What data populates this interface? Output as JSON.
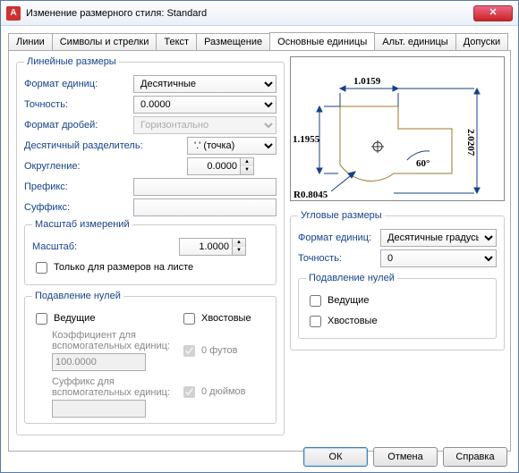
{
  "window": {
    "title": "Изменение размерного стиля: Standard"
  },
  "tabs": {
    "t1": "Линии",
    "t2": "Символы и стрелки",
    "t3": "Текст",
    "t4": "Размещение",
    "t5": "Основные единицы",
    "t6": "Альт. единицы",
    "t7": "Допуски"
  },
  "linear": {
    "legend": "Линейные размеры",
    "format_lbl": "Формат единиц:",
    "format_val": "Десятичные",
    "precision_lbl": "Точность:",
    "precision_val": "0.0000",
    "frac_lbl": "Формат дробей:",
    "frac_val": "Горизонтально",
    "decsep_lbl": "Десятичный разделитель:",
    "decsep_val": "'.' (точка)",
    "round_lbl": "Округление:",
    "round_val": "0.0000",
    "prefix_lbl": "Префикс:",
    "prefix_val": "",
    "suffix_lbl": "Суффикс:",
    "suffix_val": ""
  },
  "scale": {
    "legend": "Масштаб измерений",
    "scale_lbl": "Масштаб:",
    "scale_val": "1.0000",
    "layout_only": "Только для размеров на листе"
  },
  "zeros": {
    "legend": "Подавление нулей",
    "leading": "Ведущие",
    "coef_lbl": "Коэффициент для вспомогательных единиц:",
    "coef_val": "100.0000",
    "suf_lbl": "Суффикс для вспомогательных единиц:",
    "suf_val": "",
    "trailing": "Хвостовые",
    "feet": "0 футов",
    "inches": "0 дюймов"
  },
  "ang": {
    "legend": "Угловые размеры",
    "format_lbl": "Формат единиц:",
    "format_val": "Десятичные градусы",
    "precision_lbl": "Точность:",
    "precision_val": "0",
    "zeros_legend": "Подавление нулей",
    "leading": "Ведущие",
    "trailing": "Хвостовые"
  },
  "preview": {
    "d1": "1.0159",
    "d2": "1.1955",
    "d3": "2.0207",
    "d4": "60°",
    "d5": "R0.8045"
  },
  "buttons": {
    "ok": "ОК",
    "cancel": "Отмена",
    "help": "Справка"
  }
}
